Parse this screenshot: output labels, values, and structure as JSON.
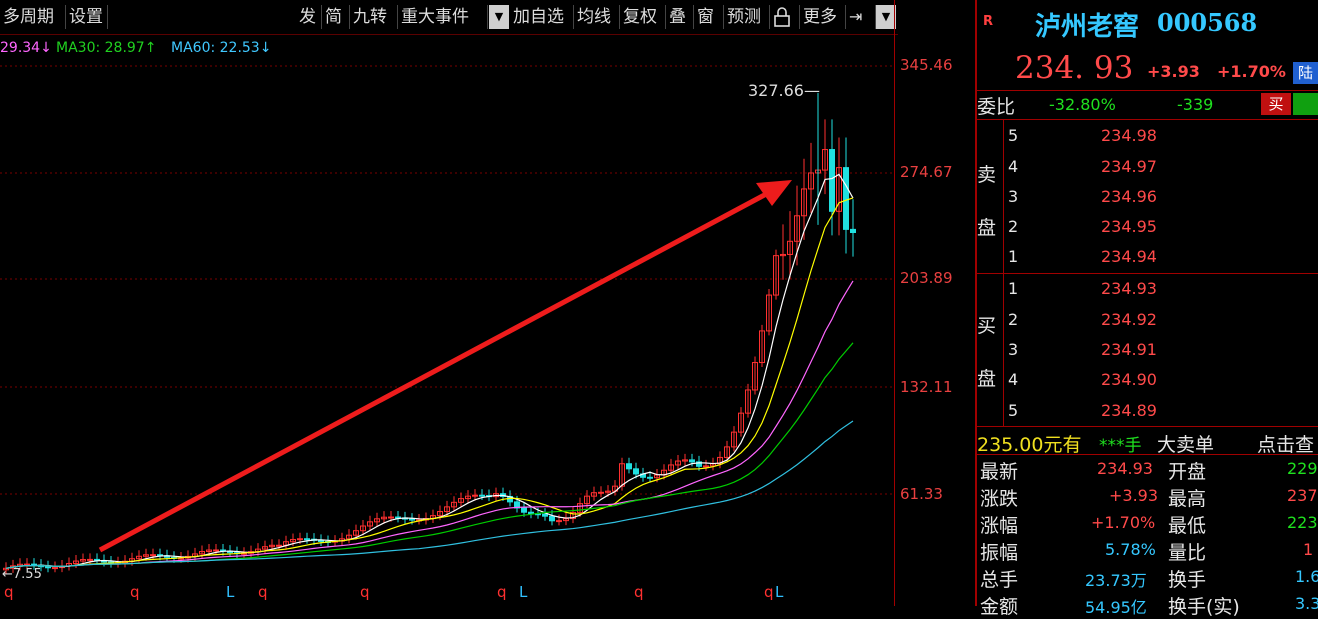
{
  "toolbar": {
    "multi_period": "多周期",
    "settings": "设置",
    "fa": "发",
    "jian": "简",
    "jiuzhuan": "九转",
    "major_events": "重大事件",
    "add_watch": "加自选",
    "ma_line": "均线",
    "rights": "复权",
    "overlay": "叠",
    "window": "窗",
    "forecast": "预测",
    "more": "更多"
  },
  "ma_legend": {
    "ma20": "29.34↓",
    "ma30": "MA30: 28.97↑",
    "ma60": "MA60: 22.53↓"
  },
  "chart_data": {
    "type": "candlestick",
    "y_ticks": [
      "345.46",
      "274.67",
      "203.89",
      "132.11",
      "61.33"
    ],
    "max_label": "327.66",
    "min_label": "7.55",
    "markers": [
      "q",
      "q",
      "L",
      "q",
      "q",
      "q",
      "L",
      "q",
      "q",
      "L"
    ],
    "colors": {
      "up": "#ff3030",
      "down": "#20e0e0",
      "ma5": "#ffffff",
      "ma10": "#ffff00",
      "ma20": "#ff66ff",
      "ma30": "#00cc00",
      "ma60": "#30c0e0"
    }
  },
  "quote": {
    "r_badge": "R",
    "name": "泸州老窖",
    "code": "000568",
    "price": "234. 93",
    "change": "+3.93",
    "change_pct": "+1.70%",
    "lu_badge": "陆",
    "weibi_label": "委比",
    "weibi_pct": "-32.80%",
    "weibi_diff": "-339",
    "buy_btn": "买",
    "sell_label_1": "卖",
    "sell_label_2": "盘",
    "buy_label_1": "买",
    "buy_label_2": "盘",
    "asks": [
      {
        "level": "5",
        "price": "234.98"
      },
      {
        "level": "4",
        "price": "234.97"
      },
      {
        "level": "3",
        "price": "234.96"
      },
      {
        "level": "2",
        "price": "234.95"
      },
      {
        "level": "1",
        "price": "234.94"
      }
    ],
    "bids": [
      {
        "level": "1",
        "price": "234.93"
      },
      {
        "level": "2",
        "price": "234.92"
      },
      {
        "level": "3",
        "price": "234.91"
      },
      {
        "level": "4",
        "price": "234.90"
      },
      {
        "level": "5",
        "price": "234.89"
      }
    ],
    "big_order_price": "235.00元有",
    "big_order_qty": "***手",
    "big_order_type": "大卖单",
    "big_order_link": "点击查",
    "stats": [
      {
        "l1": "最新",
        "v1": "234.93",
        "l2": "开盘",
        "v2": "229"
      },
      {
        "l1": "涨跌",
        "v1": "+3.93",
        "l2": "最高",
        "v2": "237"
      },
      {
        "l1": "涨幅",
        "v1": "+1.70%",
        "l2": "最低",
        "v2": "223"
      },
      {
        "l1": "振幅",
        "v1": "5.78%",
        "l2": "量比",
        "v2": "1"
      },
      {
        "l1": "总手",
        "v1": "23.73万",
        "l2": "换手",
        "v2": "1.6"
      },
      {
        "l1": "金额",
        "v1": "54.95亿",
        "l2": "换手(实)",
        "v2": "3.3"
      }
    ]
  }
}
